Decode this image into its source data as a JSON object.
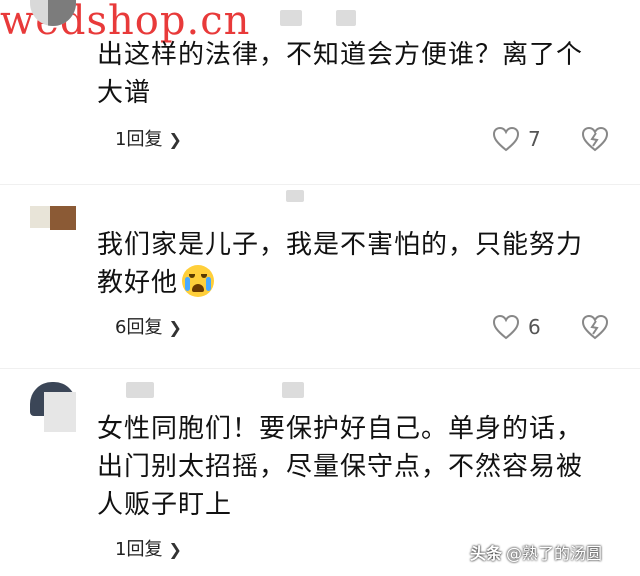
{
  "watermark": {
    "site": "wedshop.cn",
    "platform": "头条",
    "author": "@熟了的汤圆"
  },
  "comments": [
    {
      "text": "出这样的法律，不知道会方便谁？离了个大谱",
      "replies": "1回复",
      "likes": "7"
    },
    {
      "text": "我们家是儿子，我是不害怕的，只能努力教好他",
      "replies": "6回复",
      "likes": "6",
      "emoji": "loudly-crying-face"
    },
    {
      "text": "女性同胞们！要保护好自己。单身的话，出门别太招摇，尽量保守点，不然容易被人贩子盯上",
      "replies": "1回复"
    }
  ],
  "colors": {
    "watermark": "#e83a3a",
    "icon": "#888888",
    "text": "#111111"
  }
}
